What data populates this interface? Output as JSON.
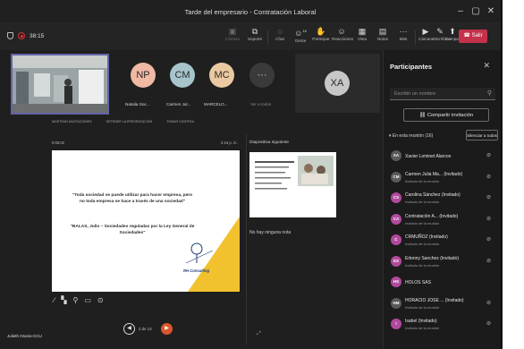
{
  "window": {
    "title": "Tarde del empresario - Contratación Laboral"
  },
  "toolbar": {
    "elapsed": "38:15",
    "tools": [
      {
        "label": "Cámara",
        "icon": "camera-icon",
        "disabled": true
      },
      {
        "label": "Soporte",
        "icon": "share-tray-icon",
        "disabled": false
      },
      {
        "label": "Chat",
        "icon": "chat-icon",
        "disabled": false
      },
      {
        "label": "Gente",
        "icon": "people-icon",
        "count": "16",
        "disabled": false
      },
      {
        "label": "Participar",
        "icon": "raise-hand-icon",
        "disabled": false
      },
      {
        "label": "Reacciones",
        "icon": "smile-icon",
        "disabled": false
      },
      {
        "label": "Vista",
        "icon": "layout-icon",
        "disabled": false
      },
      {
        "label": "Notas",
        "icon": "notes-icon",
        "disabled": false
      },
      {
        "label": "Más",
        "icon": "more-icon",
        "disabled": false
      },
      {
        "label": "Cámara",
        "icon": "camera-off-icon",
        "disabled": false
      },
      {
        "label": "Micrófono",
        "icon": "mic-icon",
        "disabled": false
      },
      {
        "label": "Compartir",
        "icon": "share-screen-icon",
        "disabled": false
      }
    ],
    "leave_label": "Salir"
  },
  "stage": {
    "avatars": [
      {
        "initials": "NP",
        "name": "Natalia Gar...",
        "color": "#f0b9a3"
      },
      {
        "initials": "CM",
        "name": "Carmen Jul...",
        "color": "#a7c4cc"
      },
      {
        "initials": "MC",
        "name": "MARCELO...",
        "color": "#ebc9a0"
      },
      {
        "initials": "···",
        "name": "Ver a todos",
        "color": "#3a3a3a"
      }
    ],
    "tile_initials": "XA",
    "share_bar": [
      "MOSTRAR ANOTACIONES",
      "DETENER LA PRESENTACIÓN",
      "TOMAR CONTROL"
    ],
    "presenter": {
      "elapsed": "0:05:02",
      "clock": "2:15 p. m.",
      "next_label": "Diapositiva siguiente",
      "slide_quote_1": "\"Toda sociedad se puede utilizar para hacer empresa, pero no toda empresa se hace a través de una sociedad\"",
      "slide_quote_2": "\"BALAS, Julio – Sociedades reguladas por la Ley General de Sociedades\"",
      "brand": "RH Consulting",
      "no_notes": "No hay ninguna nota",
      "page": "2 de 14",
      "presenter_name": "Julieth Osorio-CCU"
    }
  },
  "participants": {
    "title": "Participantes",
    "search_placeholder": "Escribir un nombre",
    "share_invite": "Compartir invitación",
    "in_meeting": "En esta reunión (16)",
    "mute_all": "Silenciar a todos",
    "people": [
      {
        "initials": "XA",
        "name": "Xavier Lominet Alarcon",
        "sub": "",
        "color": "#5a5a5a"
      },
      {
        "initials": "CM",
        "name": "Carmen Julia Ma... (Invitado)",
        "sub": "Invitado de la reunión",
        "color": "#5a5a5a"
      },
      {
        "initials": "CS",
        "name": "Carolina Sánchez (Invitado)",
        "sub": "Invitado de la reunión",
        "color": "#b04a9c"
      },
      {
        "initials": "CA",
        "name": "Contratación A... (Invitado)",
        "sub": "Invitado de la reunión",
        "color": "#b04a9c"
      },
      {
        "initials": "C",
        "name": "CRMUÑOZ (Invitado)",
        "sub": "Invitado de la reunión",
        "color": "#b04a9c"
      },
      {
        "initials": "ES",
        "name": "Erlenny Sanchez (Invitado)",
        "sub": "Invitado de la reunión",
        "color": "#b04a9c"
      },
      {
        "initials": "HS",
        "name": "HOLOS SAS",
        "sub": "",
        "color": "#b04a9c"
      },
      {
        "initials": "HM",
        "name": "HORACIO JOSE ... (Invitado)",
        "sub": "Invitado de la reunión",
        "color": "#5a5a5a"
      },
      {
        "initials": "I",
        "name": "Isabel (Invitado)",
        "sub": "Invitado de la reunión",
        "color": "#b04a9c"
      }
    ]
  },
  "colors": {
    "accent": "#6264a7",
    "leave": "#c4314b",
    "next_button": "#d9572c"
  }
}
